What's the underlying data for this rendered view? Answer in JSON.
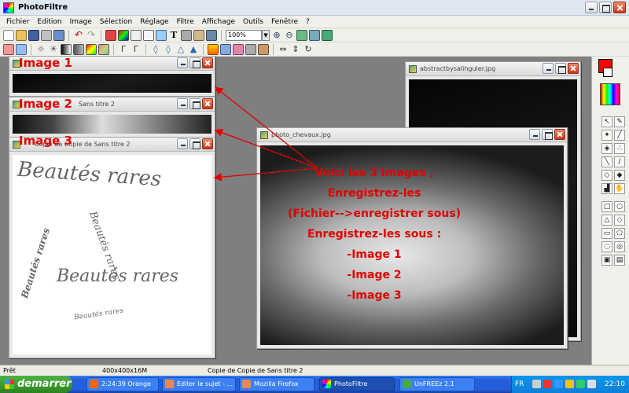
{
  "app": {
    "title": "PhotoFiltre",
    "menu": [
      "Fichier",
      "Edition",
      "Image",
      "Sélection",
      "Réglage",
      "Filtre",
      "Affichage",
      "Outils",
      "Fenêtre",
      "?"
    ]
  },
  "toolbar": {
    "zoom_value": "100%"
  },
  "windows": {
    "image1_title": "",
    "image2_title": "Sans titre 2",
    "image3_title": "Copie de Copie de Sans titre 2",
    "abstract_title": "abstractbysalihguler.jpg",
    "horses_title": "photo_chevaux.jpg"
  },
  "canvas_text": {
    "line1": "Beautés rares",
    "line2": "Beautés rares",
    "line3": "Beautés rares",
    "line4": "Beautés rares",
    "line5": "Beautés rares"
  },
  "annotations": {
    "label1": "Image 1",
    "label2": "Image 2",
    "label3": "Image 3",
    "message": [
      "Voici les 3 images ,",
      "Enregistrez-les",
      "(Fichier-->enregistrer sous)",
      "Enregistrez-les sous :",
      "-Image 1",
      "-Image 2",
      "-Image 3"
    ]
  },
  "status": {
    "state": "Prêt",
    "size": "400x400x16M",
    "doc": "Copie de Copie de Sans titre 2"
  },
  "taskbar": {
    "start": "demarrer",
    "tasks": [
      {
        "label": "2:24:39 Orange"
      },
      {
        "label": "Editer le sujet - ..."
      },
      {
        "label": "Mozilla Firefox"
      },
      {
        "label": "PhotoFiltre"
      },
      {
        "label": "UnFREEz 2.1"
      }
    ],
    "lang": "FR",
    "clock": "22:10"
  },
  "colors": {
    "foreground": "#ff0000",
    "background": "#ffffff",
    "annotation": "#e00000"
  }
}
